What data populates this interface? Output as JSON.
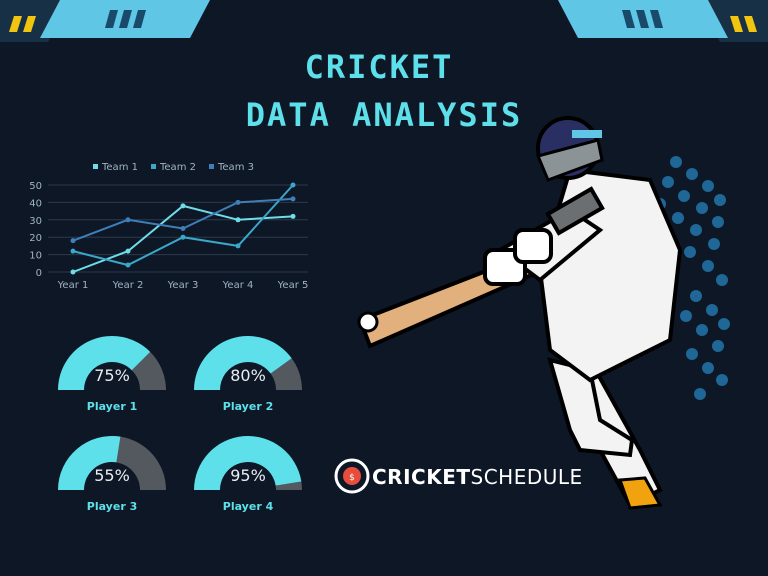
{
  "title": {
    "line1": "CRICKET",
    "line2": "DATA ANALYSIS"
  },
  "colors": {
    "background": "#0e1726",
    "accent": "#5ee0ea",
    "team1": "#6fdde8",
    "team2": "#3ba7c9",
    "team3": "#3e7fb8",
    "gauge_fill": "#5ee0ea",
    "gauge_rest": "#53595f"
  },
  "chart_data": [
    {
      "type": "line",
      "title": "",
      "xlabel": "",
      "ylabel": "",
      "categories": [
        "Year 1",
        "Year 2",
        "Year 3",
        "Year 4",
        "Year 5"
      ],
      "ylim": [
        0,
        50
      ],
      "yticks": [
        0,
        10,
        20,
        30,
        40,
        50
      ],
      "grid": true,
      "legend": "top",
      "series": [
        {
          "name": "Team 1",
          "values": [
            0,
            12,
            38,
            30,
            32
          ]
        },
        {
          "name": "Team 2",
          "values": [
            12,
            4,
            20,
            15,
            50
          ]
        },
        {
          "name": "Team 3",
          "values": [
            18,
            30,
            25,
            40,
            42
          ]
        }
      ]
    },
    {
      "type": "gauge",
      "gauges": [
        {
          "label": "Player 1",
          "value": 75,
          "display": "75%"
        },
        {
          "label": "Player 2",
          "value": 80,
          "display": "80%"
        },
        {
          "label": "Player 3",
          "value": 55,
          "display": "55%"
        },
        {
          "label": "Player 4",
          "value": 95,
          "display": "95%"
        }
      ]
    }
  ],
  "brand": {
    "bold": "CRICKET",
    "light": "SCHEDULE"
  },
  "icons": {
    "logo": "cricket-ball-logo-icon",
    "illustration": "cricket-batsman-illustration"
  }
}
